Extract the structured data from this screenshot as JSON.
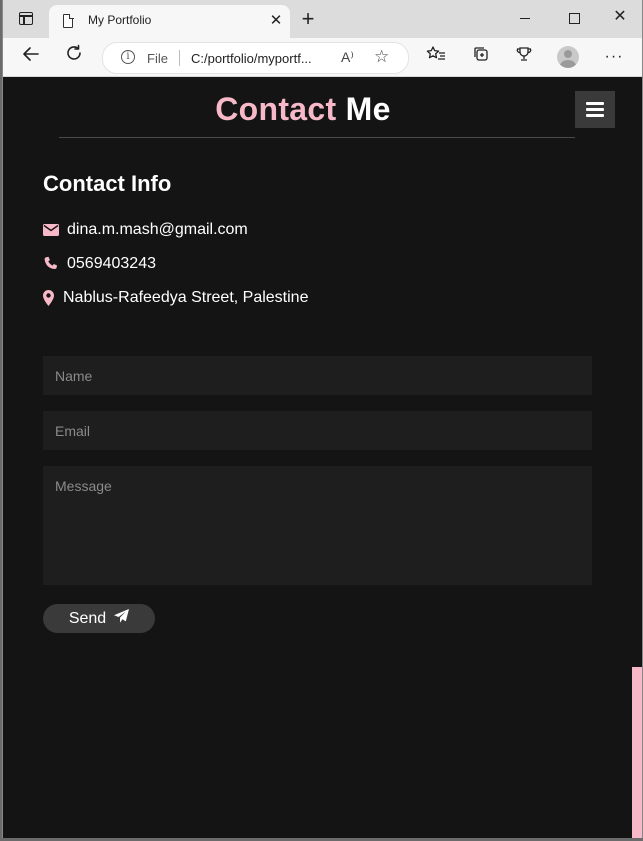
{
  "browser": {
    "tab_title": "My Portfolio",
    "new_tab_glyph": "+",
    "address_scheme": "File",
    "address_url": "C:/portfolio/myportf...",
    "icons": [
      "tab-actions-icon",
      "page-icon",
      "close-icon",
      "back-icon",
      "reload-icon",
      "info-icon",
      "read-aloud-icon",
      "add-favorite-icon",
      "favorites-icon",
      "collections-icon",
      "extensions-icon",
      "profile-icon",
      "more-icon",
      "minimize-icon",
      "maximize-icon"
    ]
  },
  "header": {
    "title_accent": "Contact",
    "title_rest": "Me",
    "menu_icon": "hamburger-menu-icon"
  },
  "contact_info": {
    "title": "Contact Info",
    "email": "dina.m.mash@gmail.com",
    "phone": "0569403243",
    "address": "Nablus-Rafeedya Street, Palestine"
  },
  "form": {
    "name_placeholder": "Name",
    "email_placeholder": "Email",
    "message_placeholder": "Message",
    "send_label": "Send"
  },
  "colors": {
    "accent": "#f7b9c8",
    "background": "#141414",
    "field": "#1e1e1e",
    "button": "#3a3a3a"
  }
}
